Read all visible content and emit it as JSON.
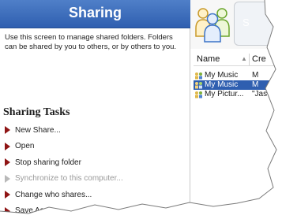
{
  "header": {
    "title": "Sharing"
  },
  "description": "Use this screen to manage shared folders. Folders can be shared by you to others, or by others to you.",
  "tasks": {
    "title": "Sharing Tasks",
    "items": [
      {
        "label": "New Share...",
        "enabled": true
      },
      {
        "label": "Open",
        "enabled": true
      },
      {
        "label": "Stop sharing folder",
        "enabled": true
      },
      {
        "label": "Synchronize to this computer...",
        "enabled": false
      },
      {
        "label": "Change who shares...",
        "enabled": true
      },
      {
        "label": "Save As...",
        "enabled": true
      }
    ]
  },
  "toolbar": {
    "tab_label": "S"
  },
  "list": {
    "columns": {
      "name": "Name",
      "creator": "Cre"
    },
    "rows": [
      {
        "name": "My Music",
        "creator": "M",
        "selected": false
      },
      {
        "name": "My Music",
        "creator": "M",
        "selected": true
      },
      {
        "name": "My Pictur...",
        "creator": "\"Jas",
        "selected": false
      }
    ]
  },
  "colors": {
    "banner": "#2f5fb0",
    "task_arrow": "#8f1515",
    "selection": "#2f5fb0"
  }
}
